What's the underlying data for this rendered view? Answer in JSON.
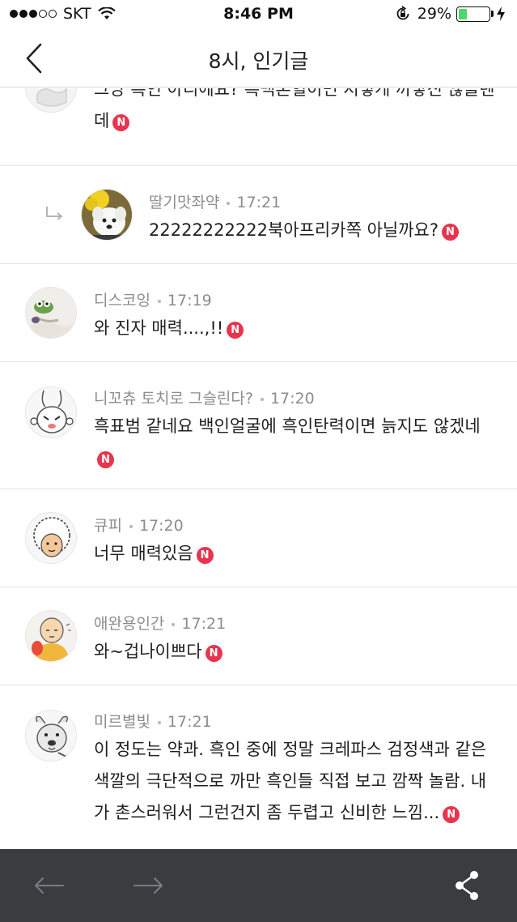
{
  "status_bar": {
    "carrier": "SKT",
    "time": "8:46 PM",
    "battery_percent": "29%",
    "battery_level": 0.29,
    "signal_bars_filled": 3,
    "signal_bars_total": 5
  },
  "nav": {
    "title": "8시, 인기글",
    "back_icon": "chevron-left-icon"
  },
  "comments": [
    {
      "author": "",
      "time": "",
      "text": "그냥 흑인 아니에요? 흑백혼혈이면 저렇게 까맣진 않을텐데",
      "new_badge": "N",
      "avatar": "avatar-partial",
      "is_reply": false
    },
    {
      "author": "딸기맛좌약",
      "time": "17:21",
      "text": "22222222222북아프리카쪽 아닐까요?",
      "new_badge": "N",
      "avatar": "avatar-puppy",
      "is_reply": true
    },
    {
      "author": "디스코잉",
      "time": "17:19",
      "text": "와 진자 매력....,!!",
      "new_badge": "N",
      "avatar": "avatar-frog",
      "is_reply": false
    },
    {
      "author": "니꼬츄 토치로 그슬린다?",
      "time": "17:20",
      "text": "흑표범 같네요 백인얼굴에 흑인탄력이면 늙지도 않겠네",
      "new_badge": "N",
      "avatar": "avatar-bunny",
      "is_reply": false
    },
    {
      "author": "큐피",
      "time": "17:20",
      "text": "너무 매력있음",
      "new_badge": "N",
      "avatar": "avatar-afro",
      "is_reply": false
    },
    {
      "author": "애완용인간",
      "time": "17:21",
      "text": "와~겁나이쁘다",
      "new_badge": "N",
      "avatar": "avatar-saitama",
      "is_reply": false
    },
    {
      "author": "미르별빛",
      "time": "17:21",
      "text": "이 정도는 약과. 흑인 중에 정말 크레파스 검정색과 같은 색깔의 극단적으로 까만 흑인들 직접 보고 깜짝 놀람. 내가 촌스러워서 그런건지 좀 두렵고 신비한 느낌...",
      "new_badge": "N",
      "avatar": "avatar-dog",
      "is_reply": false
    }
  ],
  "bottom_bar": {
    "back_icon": "arrow-left-icon",
    "forward_icon": "arrow-right-icon",
    "share_icon": "share-icon"
  },
  "colors": {
    "badge_red": "#e8344e",
    "bottom_bar": "#3b3c40",
    "battery_green": "#4cd964",
    "meta_gray": "#8d8d8d"
  }
}
